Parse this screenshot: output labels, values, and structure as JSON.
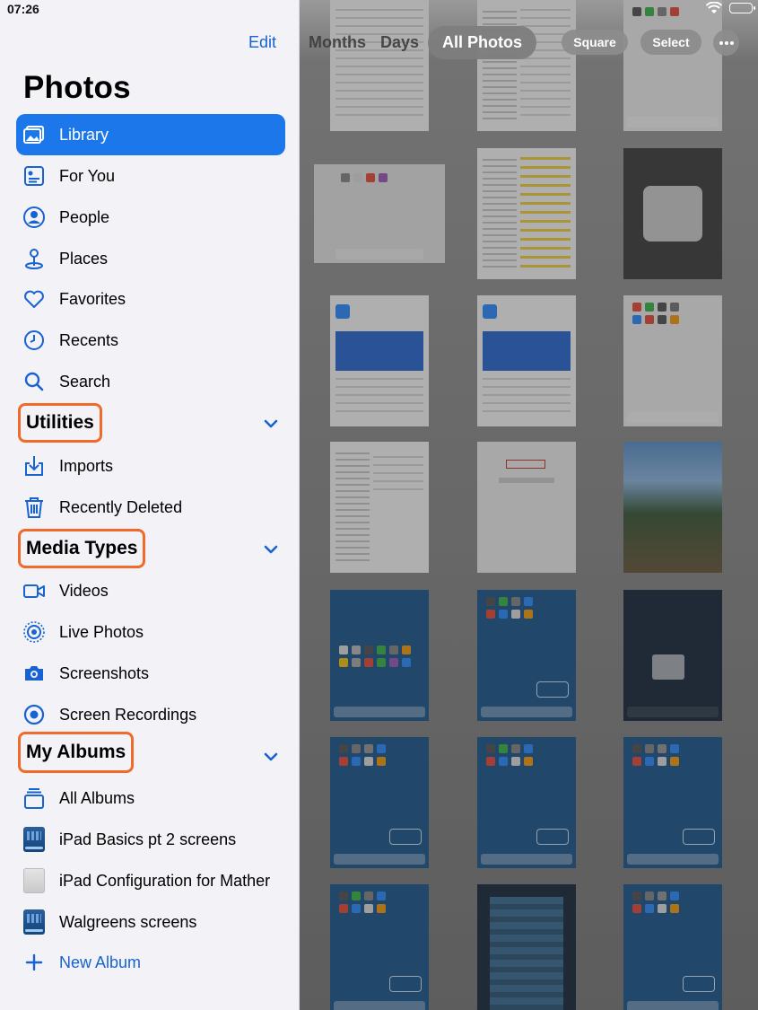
{
  "status_bar": {
    "time": "07:26"
  },
  "sidebar": {
    "edit_label": "Edit",
    "title": "Photos",
    "items": [
      {
        "label": "Library",
        "icon": "library-icon",
        "selected": true
      },
      {
        "label": "For You",
        "icon": "for-you-icon"
      },
      {
        "label": "People",
        "icon": "people-icon"
      },
      {
        "label": "Places",
        "icon": "places-icon"
      },
      {
        "label": "Favorites",
        "icon": "heart-icon"
      },
      {
        "label": "Recents",
        "icon": "clock-icon"
      },
      {
        "label": "Search",
        "icon": "search-icon"
      }
    ],
    "utilities": {
      "header": "Utilities",
      "items": [
        {
          "label": "Imports",
          "icon": "import-icon"
        },
        {
          "label": "Recently Deleted",
          "icon": "trash-icon"
        }
      ]
    },
    "media_types": {
      "header": "Media Types",
      "items": [
        {
          "label": "Videos",
          "icon": "video-icon"
        },
        {
          "label": "Live Photos",
          "icon": "live-photos-icon"
        },
        {
          "label": "Screenshots",
          "icon": "screenshot-icon"
        },
        {
          "label": "Screen Recordings",
          "icon": "screen-recording-icon"
        }
      ]
    },
    "my_albums": {
      "header": "My Albums",
      "items": [
        {
          "label": "All Albums",
          "icon": "albums-stack-icon"
        },
        {
          "label": "iPad Basics pt 2 screens",
          "icon": "album-thumbnail-icon"
        },
        {
          "label": "iPad Configuration for Mather",
          "icon": "album-thumbnail-icon"
        },
        {
          "label": "Walgreens screens",
          "icon": "album-thumbnail-icon"
        },
        {
          "label": "New Album",
          "icon": "plus-icon"
        }
      ]
    }
  },
  "toolbar": {
    "tabs": [
      "Months",
      "Days",
      "All Photos"
    ],
    "active_tab": "All Photos",
    "square_label": "Square",
    "select_label": "Select"
  },
  "colors": {
    "accent": "#1c78ea",
    "link": "#1763d1",
    "highlight_outline": "#f06b2b",
    "sidebar_bg": "#f2f2f7"
  }
}
